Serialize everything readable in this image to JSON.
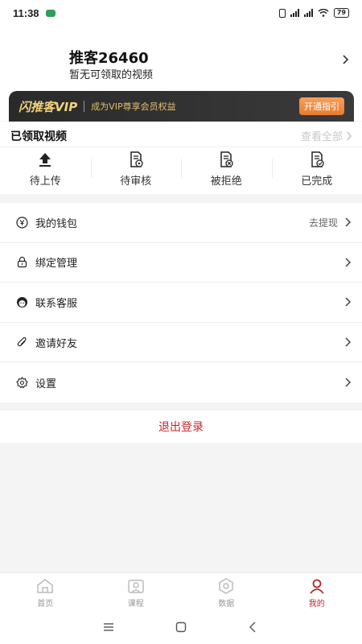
{
  "status": {
    "time": "11:38",
    "battery": "79"
  },
  "header": {
    "username": "推客26460",
    "subtitle": "暂无可领取的视频"
  },
  "vip": {
    "title": "闪推客VIP",
    "desc": "成为VIP尊享会员权益",
    "button": "开通指引"
  },
  "videos": {
    "title": "已领取视频",
    "view_all": "查看全部",
    "items": [
      {
        "label": "待上传",
        "icon": "upload-icon"
      },
      {
        "label": "待审核",
        "icon": "review-document-icon"
      },
      {
        "label": "被拒绝",
        "icon": "rejected-document-icon"
      },
      {
        "label": "已完成",
        "icon": "completed-document-icon"
      }
    ]
  },
  "menu": [
    {
      "label": "我的钱包",
      "extra": "去提现",
      "icon": "wallet-icon"
    },
    {
      "label": "绑定管理",
      "extra": "",
      "icon": "lock-icon"
    },
    {
      "label": "联系客服",
      "extra": "",
      "icon": "customer-service-icon"
    },
    {
      "label": "邀请好友",
      "extra": "",
      "icon": "paperclip-icon"
    },
    {
      "label": "设置",
      "extra": "",
      "icon": "settings-icon"
    }
  ],
  "logout": "退出登录",
  "tabs": [
    {
      "label": "首页",
      "icon": "home-icon",
      "active": false
    },
    {
      "label": "课程",
      "icon": "course-icon",
      "active": false
    },
    {
      "label": "数据",
      "icon": "data-icon",
      "active": false
    },
    {
      "label": "我的",
      "icon": "profile-icon",
      "active": true
    }
  ],
  "colors": {
    "accent": "#c8252b",
    "vip_gold": "#f2d37c",
    "vip_button": "#ea7a2d"
  }
}
